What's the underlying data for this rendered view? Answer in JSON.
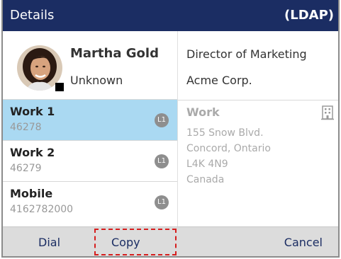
{
  "header": {
    "title": "Details",
    "source": "(LDAP)"
  },
  "contact": {
    "name": "Martha Gold",
    "status": "Unknown"
  },
  "numbers": [
    {
      "label": "Work 1",
      "number": "46278",
      "line": "L1",
      "selected": true
    },
    {
      "label": "Work 2",
      "number": "46279",
      "line": "L1",
      "selected": false
    },
    {
      "label": "Mobile",
      "number": "4162782000",
      "line": "L1",
      "selected": false
    }
  ],
  "details": {
    "job_title": "Director of Marketing",
    "company": "Acme Corp.",
    "address_type": "Work",
    "address_lines": [
      "155 Snow Blvd.",
      "Concord, Ontario",
      "L4K 4N9",
      "Canada"
    ]
  },
  "softkeys": {
    "dial": "Dial",
    "copy": "Copy",
    "cancel": "Cancel"
  },
  "colors": {
    "header_bg": "#1b2d63",
    "selected_row": "#aad9f2",
    "highlight": "#d61e1e"
  }
}
